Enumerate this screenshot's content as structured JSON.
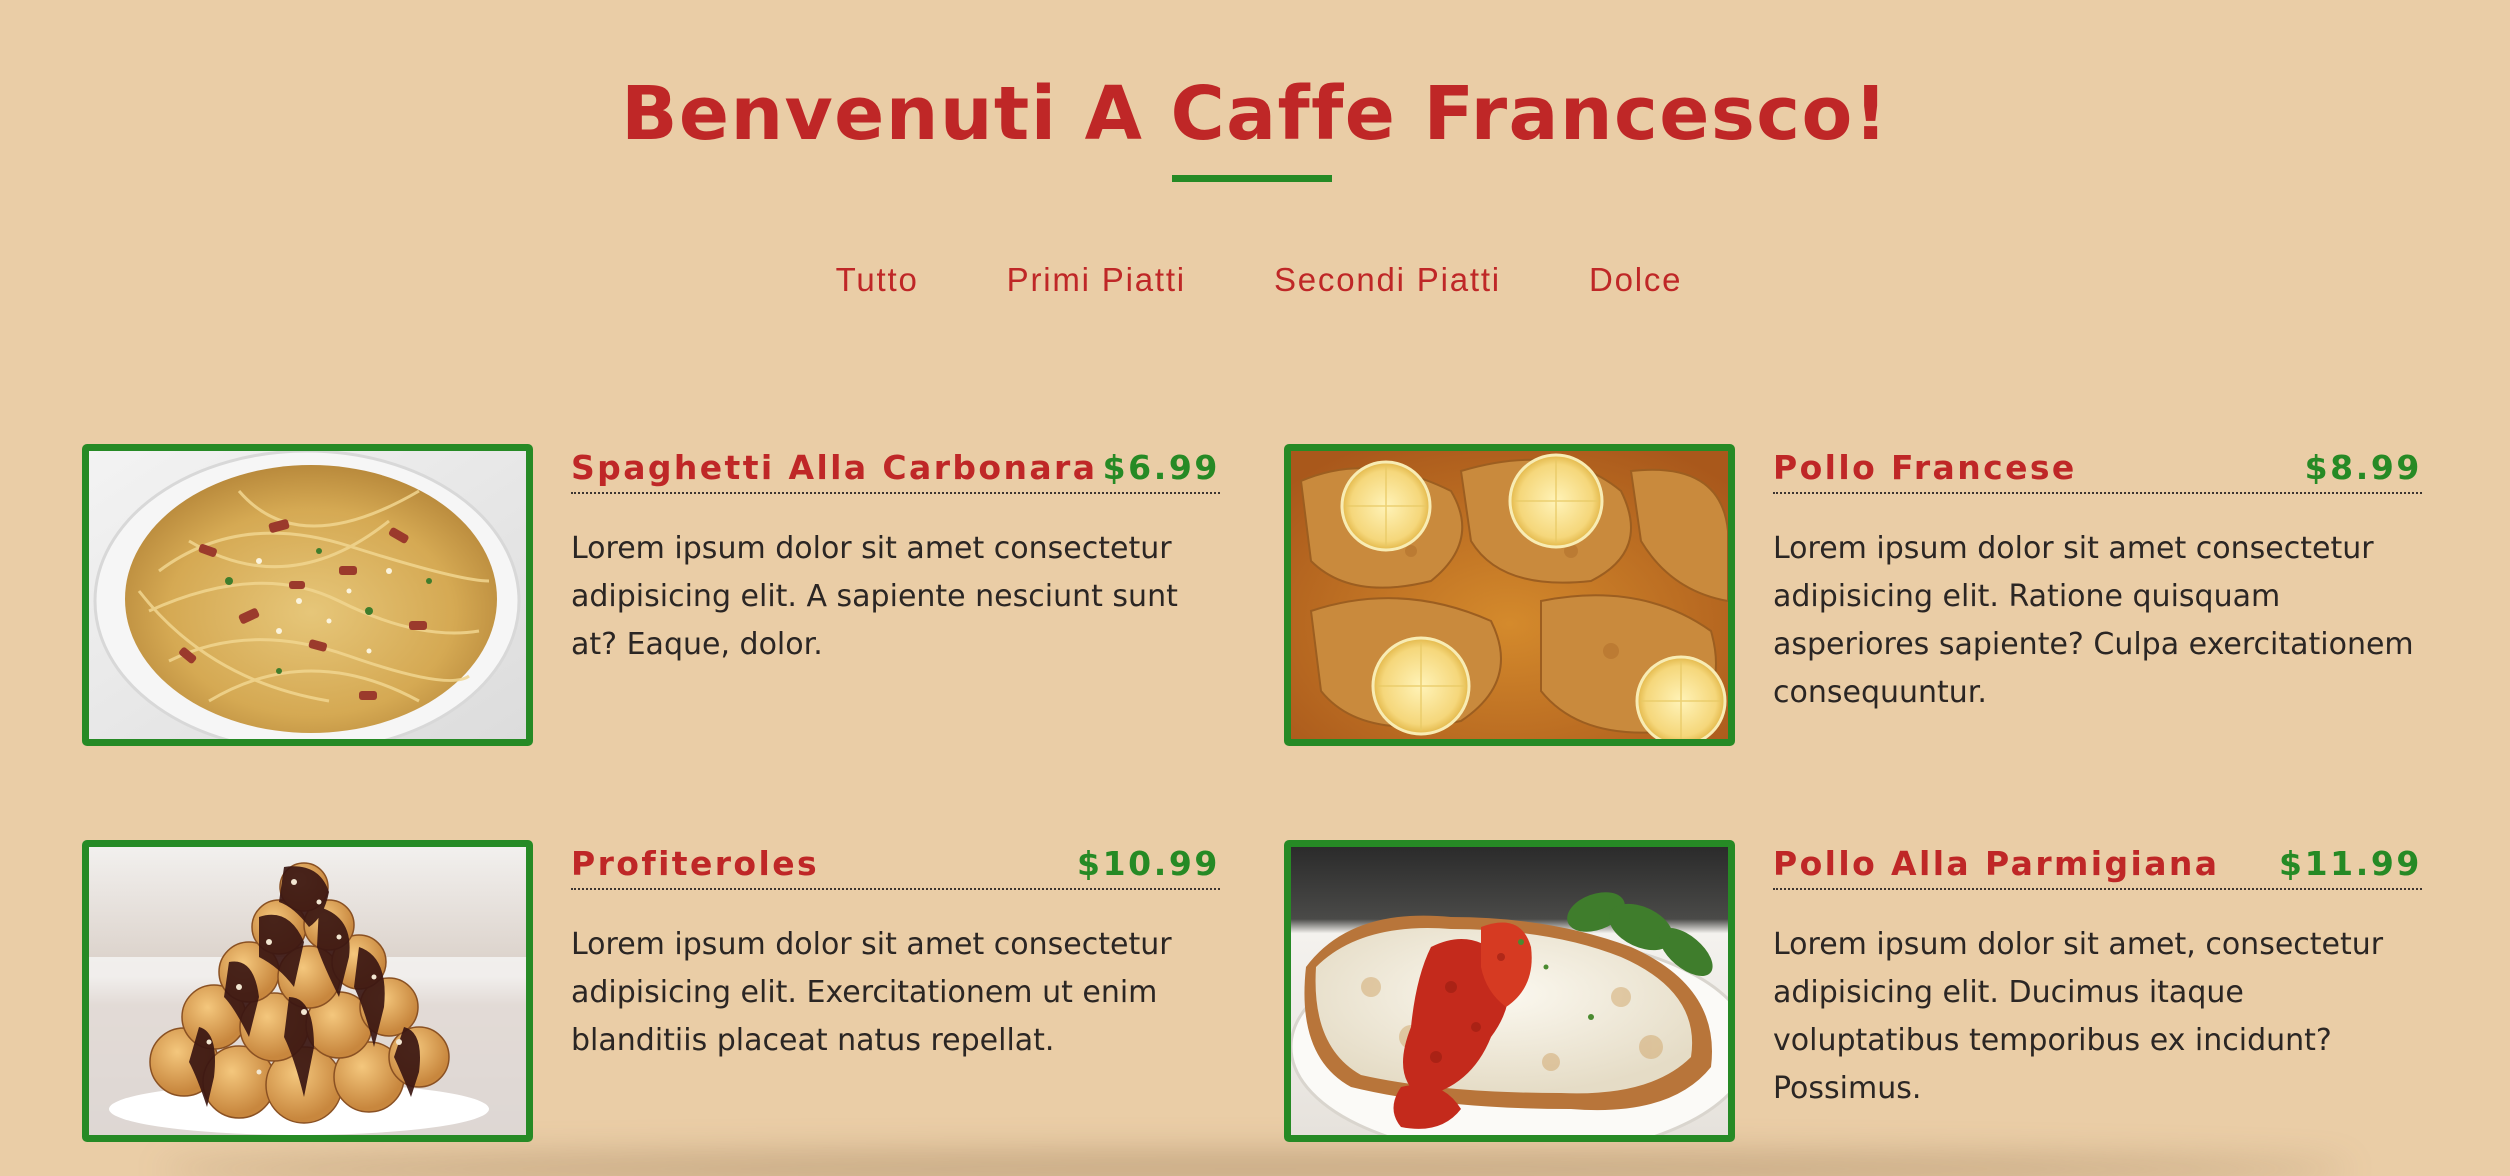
{
  "header": {
    "title": "Benvenuti A Caffe Francesco!"
  },
  "nav": {
    "items": [
      {
        "label": "Tutto"
      },
      {
        "label": "Primi Piatti"
      },
      {
        "label": "Secondi Piatti"
      },
      {
        "label": "Dolce"
      }
    ]
  },
  "menu": {
    "items": [
      {
        "name": "Spaghetti Alla Carbonara",
        "price": "$6.99",
        "description": "Lorem ipsum dolor sit amet consectetur adipisicing elit. A sapiente nesciunt sunt at? Eaque, dolor.",
        "image": "spaghetti-carbonara-photo"
      },
      {
        "name": "Pollo Francese",
        "price": "$8.99",
        "description": "Lorem ipsum dolor sit amet consectetur adipisicing elit. Ratione quisquam asperiores sapiente? Culpa exercitationem consequuntur.",
        "image": "pollo-francese-photo"
      },
      {
        "name": "Profiteroles",
        "price": "$10.99",
        "description": "Lorem ipsum dolor sit amet consectetur adipisicing elit. Exercitationem ut enim blanditiis placeat natus repellat.",
        "image": "profiteroles-photo"
      },
      {
        "name": "Pollo Alla Parmigiana",
        "price": "$11.99",
        "description": "Lorem ipsum dolor sit amet, consectetur adipisicing elit. Ducimus itaque voluptatibus temporibus ex incidunt? Possimus.",
        "image": "pollo-parmigiana-photo"
      }
    ]
  },
  "colors": {
    "background": "#eacda6",
    "accent_red": "#bf2727",
    "accent_green": "#268a25",
    "body_text": "#2b2624"
  }
}
